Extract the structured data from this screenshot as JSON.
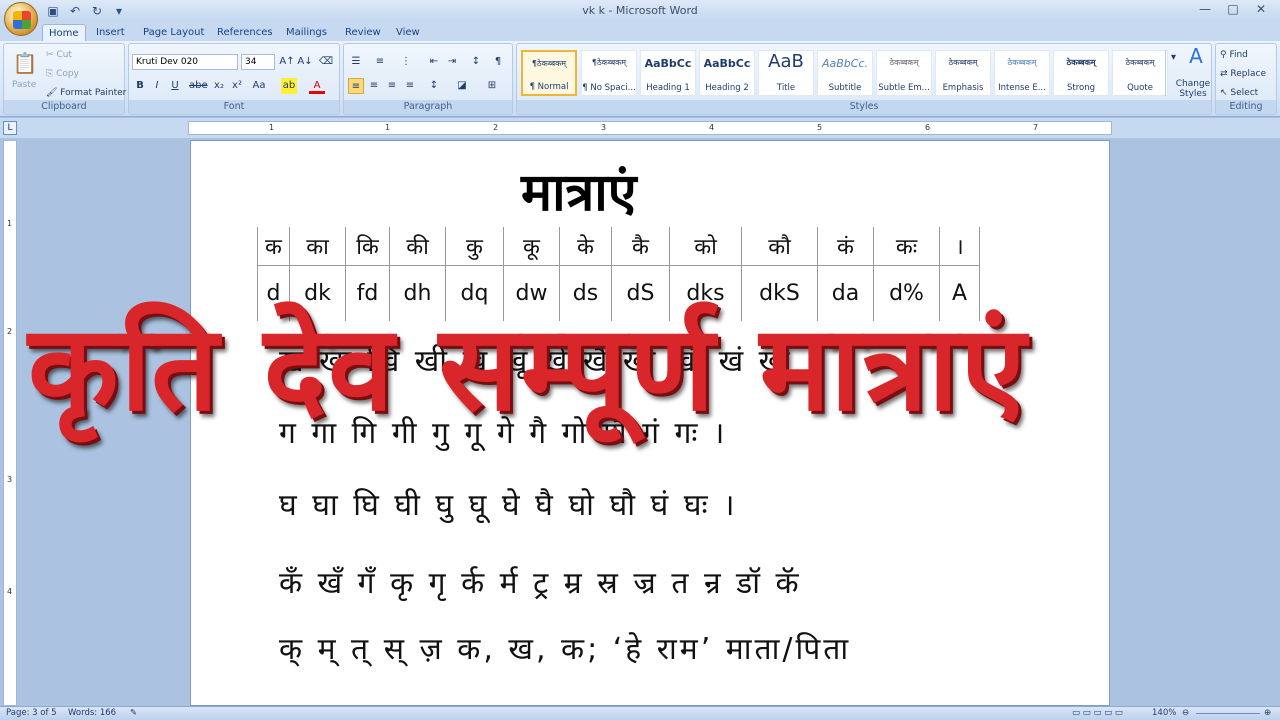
{
  "window": {
    "title": "vk        k - Microsoft Word",
    "controls": [
      "—",
      "□",
      "✕"
    ]
  },
  "tabs": [
    "Home",
    "Insert",
    "Page Layout",
    "References",
    "Mailings",
    "Review",
    "View"
  ],
  "active_tab": "Home",
  "clipboard": {
    "paste": "Paste",
    "cut": "Cut",
    "copy": "Copy",
    "format_painter": "Format Painter",
    "label": "Clipboard"
  },
  "font": {
    "name": "Kruti Dev 020",
    "size": "34",
    "label": "Font"
  },
  "paragraph": {
    "label": "Paragraph"
  },
  "styles": {
    "label": "Styles",
    "items": [
      {
        "sample": "¶ठेकब्बकम्",
        "name": "¶ Normal"
      },
      {
        "sample": "¶ठेकब्बकम्",
        "name": "¶ No Spaci..."
      },
      {
        "sample": "AaBbCc",
        "name": "Heading 1"
      },
      {
        "sample": "AaBbCc",
        "name": "Heading 2"
      },
      {
        "sample": "AaB",
        "name": "Title"
      },
      {
        "sample": "AaBbCc.",
        "name": "Subtitle"
      },
      {
        "sample": "ठेकब्बकम्",
        "name": "Subtle Em..."
      },
      {
        "sample": "ठेकब्बकम्",
        "name": "Emphasis"
      },
      {
        "sample": "ठेकब्बकम्",
        "name": "Intense E..."
      },
      {
        "sample": "ठेकब्बकम्",
        "name": "Strong"
      },
      {
        "sample": "ठेकब्बकम्",
        "name": "Quote"
      }
    ],
    "change_styles": "Change Styles"
  },
  "editing": {
    "find": "Find",
    "replace": "Replace",
    "select": "Select",
    "label": "Editing"
  },
  "ruler": [
    "1",
    "1",
    "2",
    "3",
    "4",
    "5",
    "6",
    "7"
  ],
  "vruler": [
    "1",
    "2",
    "3",
    "4"
  ],
  "document": {
    "heading": "मात्राएं",
    "table_row1": [
      "क",
      "का",
      "कि",
      "की",
      "कु",
      "कू",
      "के",
      "कै",
      "को",
      "कौ",
      "कं",
      "कः",
      "।"
    ],
    "table_row2": [
      "d",
      "dk",
      "fd",
      "dh",
      "dq",
      "dw",
      "ds",
      "dS",
      "dks",
      "dkS",
      "da",
      "d%",
      "A"
    ],
    "line1": "ख खा खि खी खु खू खे खै खो खौ खं खः ।",
    "line2": "ग गा गि गी गु गू गे गै गो गौ गं गः ।",
    "line3": "घ घा घि घी घु घू घे घै घो घौ घं घः ।",
    "line4": "कँ खँ गँ  कृ गृ र्क र्म ट्र म्र स्र ज्र त न्र डॉ कॅ",
    "line5": "क् म् त् स् ज़ क, ख, क; ‘हे राम’ माता/पिता"
  },
  "overlay_title": "कृति देव सम्पूर्ण मात्राएं",
  "status": {
    "page": "Page: 3 of 5",
    "words": "Words: 166",
    "zoom": "140%"
  }
}
